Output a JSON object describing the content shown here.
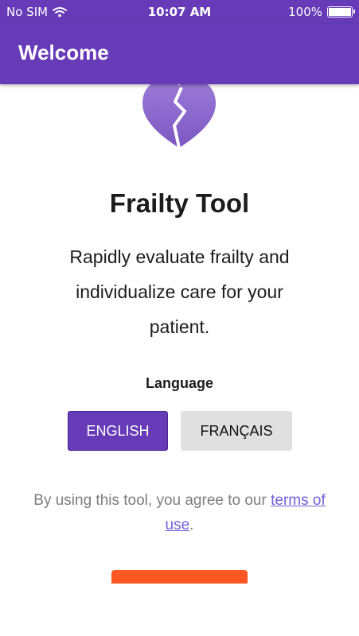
{
  "status_bar": {
    "carrier": "No SIM",
    "time": "10:07 AM",
    "battery": "100%",
    "battery_level": 1.0
  },
  "app_bar": {
    "title": "Welcome"
  },
  "main": {
    "title": "Frailty Tool",
    "tagline": "Rapidly evaluate frailty and individualize care for your patient.",
    "language_label": "Language",
    "language_options": [
      "ENGLISH",
      "FRANÇAIS"
    ],
    "selected_language": "ENGLISH",
    "terms_prefix": "By using this tool, you agree to our ",
    "terms_link": "terms of use",
    "terms_suffix": "."
  },
  "icons": {
    "app_logo": "broken-heart-icon",
    "wifi": "wifi-icon",
    "battery": "battery-icon"
  },
  "colors": {
    "primary": "#673ab7",
    "heart": "#8e6bcf",
    "cta": "#ff5722",
    "secondary_button": "#e0e0e0",
    "link": "#6f5fd6"
  }
}
